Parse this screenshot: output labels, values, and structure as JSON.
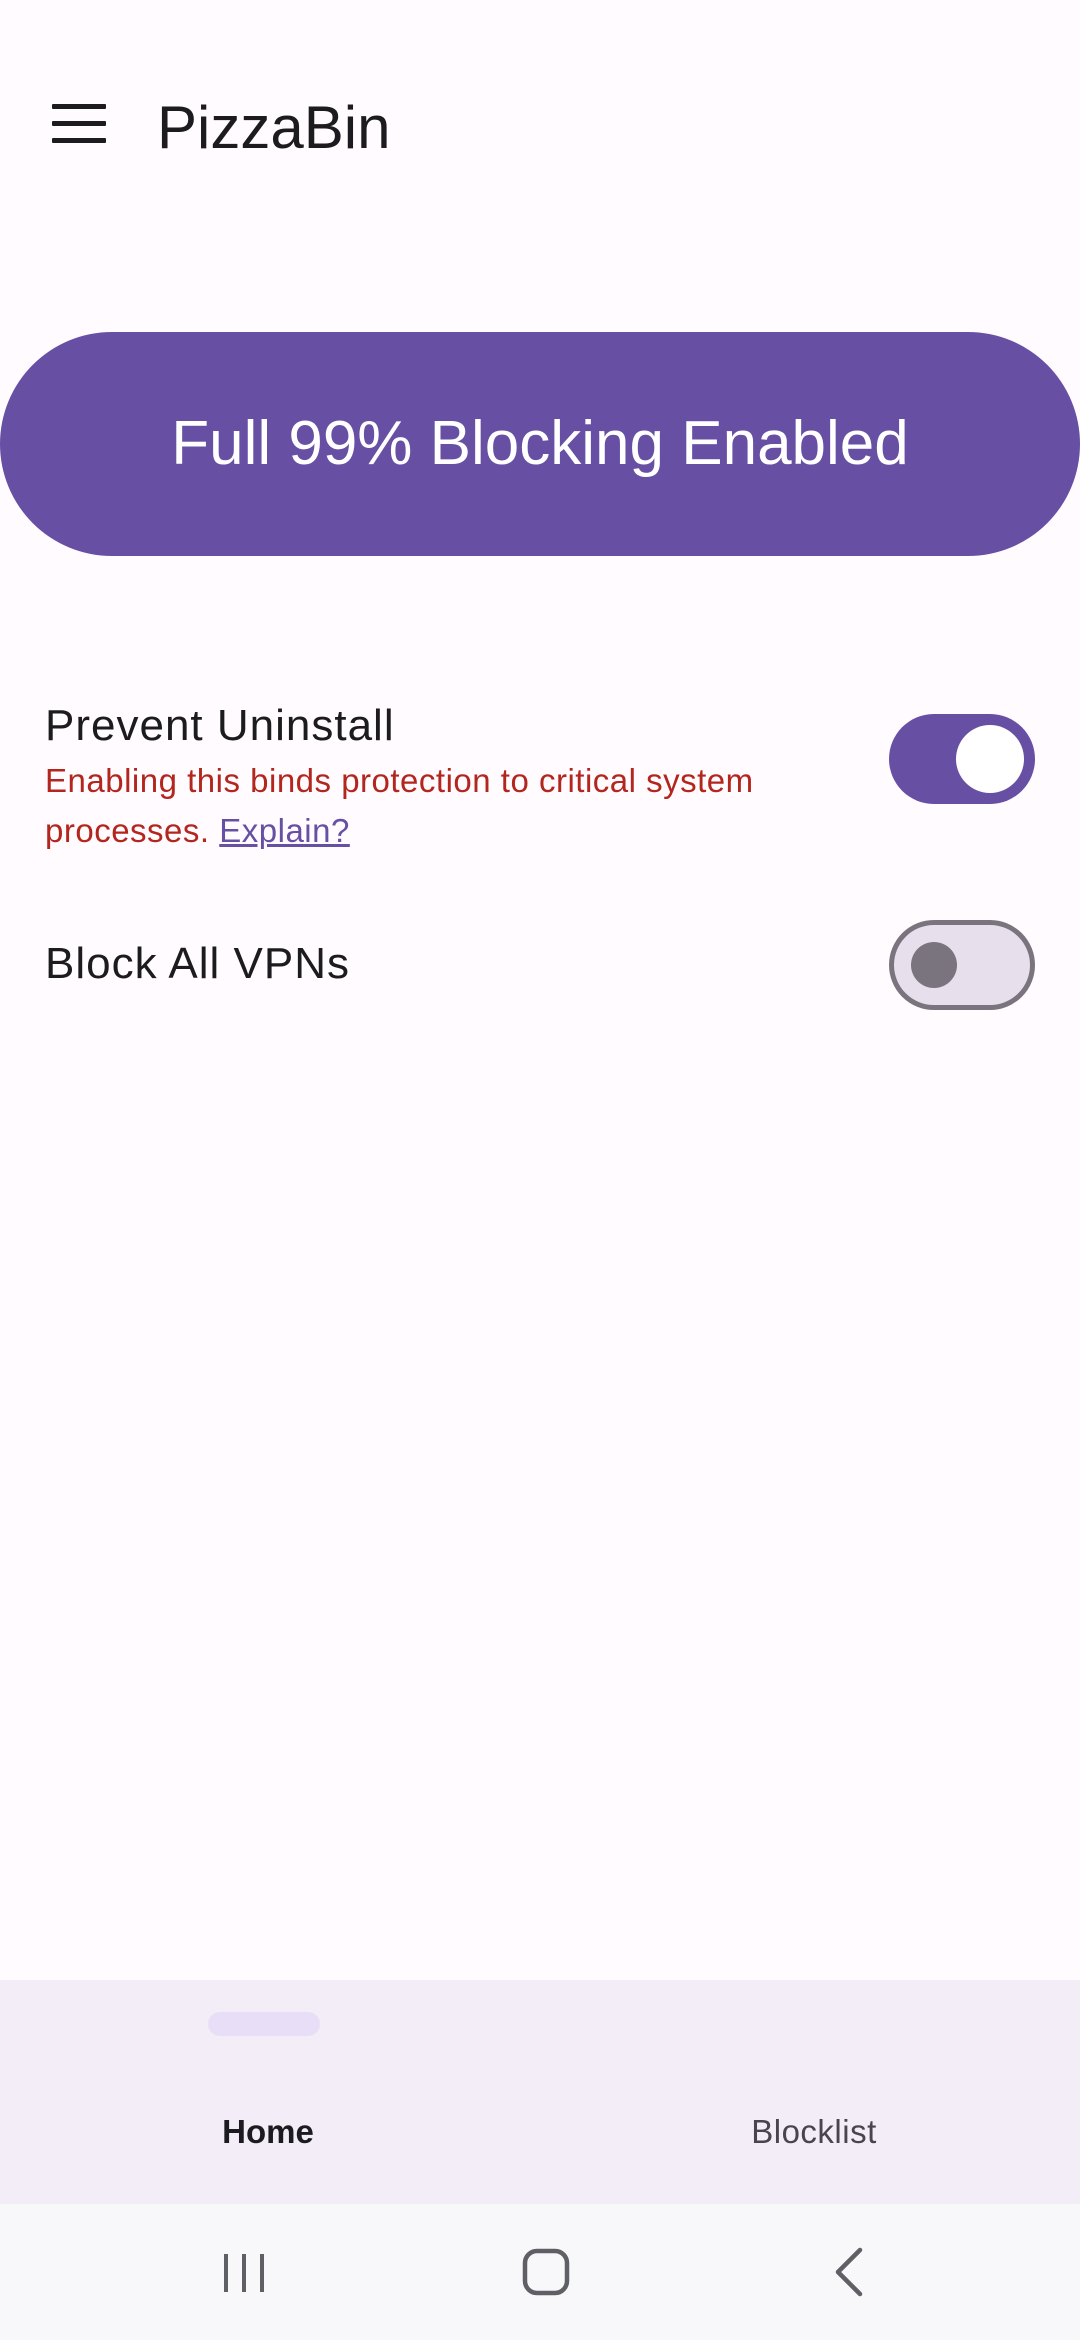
{
  "app": {
    "title": "PizzaBin"
  },
  "blocking_button": {
    "label": "Full 99% Blocking Enabled"
  },
  "settings": {
    "prevent_uninstall": {
      "title": "Prevent Uninstall",
      "description": "Enabling this binds protection to critical system processes.",
      "link": "Explain?",
      "enabled": true
    },
    "block_vpns": {
      "title": "Block All VPNs",
      "enabled": false
    }
  },
  "bottom_nav": {
    "items": [
      {
        "label": "Home",
        "selected": true
      },
      {
        "label": "Blocklist",
        "selected": false
      }
    ]
  },
  "colors": {
    "primary": "#6750a4",
    "error": "#b3261e",
    "background": "#fffbfe",
    "nav_background": "#f3edf7"
  },
  "icons": {
    "menu": "menu-icon",
    "recent_apps": "recent-apps-icon",
    "home": "home-icon",
    "back": "back-icon"
  }
}
